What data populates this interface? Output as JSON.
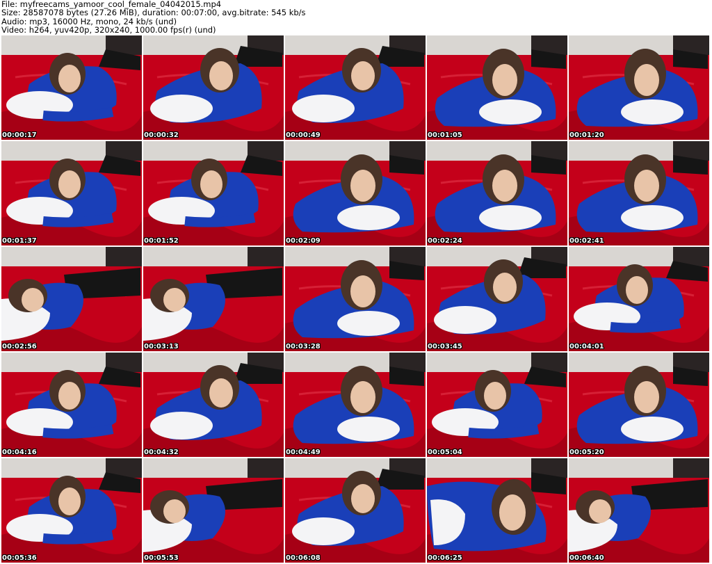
{
  "header": {
    "file_line": "File: myfreecams_yamoor_cool_female_04042015.mp4",
    "size_line": "Size: 28587078 bytes (27.26 MiB), duration: 00:07:00, avg.bitrate: 545 kb/s",
    "audio_line": "Audio: mp3, 16000 Hz, mono, 24 kb/s (und)",
    "video_line": "Video: h264, yuv420p, 320x240, 1000.00 fps(r) (und)"
  },
  "colors": {
    "sheet_red": "#c4001a",
    "sheet_dark_red": "#8e0012",
    "sweater_blue": "#1a3fb8",
    "pillow_white": "#f4f4f6",
    "hair_brown": "#4a3428",
    "skin": "#e8c4a8",
    "wall_grey": "#d9d6d2",
    "pants_black": "#151515"
  },
  "frames": [
    {
      "time": "00:00:17",
      "variant": "a"
    },
    {
      "time": "00:00:32",
      "variant": "b"
    },
    {
      "time": "00:00:49",
      "variant": "b"
    },
    {
      "time": "00:01:05",
      "variant": "c"
    },
    {
      "time": "00:01:20",
      "variant": "c"
    },
    {
      "time": "00:01:37",
      "variant": "a"
    },
    {
      "time": "00:01:52",
      "variant": "a"
    },
    {
      "time": "00:02:09",
      "variant": "c"
    },
    {
      "time": "00:02:24",
      "variant": "c"
    },
    {
      "time": "00:02:41",
      "variant": "c"
    },
    {
      "time": "00:02:56",
      "variant": "d"
    },
    {
      "time": "00:03:13",
      "variant": "d"
    },
    {
      "time": "00:03:28",
      "variant": "c"
    },
    {
      "time": "00:03:45",
      "variant": "b"
    },
    {
      "time": "00:04:01",
      "variant": "a"
    },
    {
      "time": "00:04:16",
      "variant": "a"
    },
    {
      "time": "00:04:32",
      "variant": "b"
    },
    {
      "time": "00:04:49",
      "variant": "c"
    },
    {
      "time": "00:05:04",
      "variant": "a"
    },
    {
      "time": "00:05:20",
      "variant": "c"
    },
    {
      "time": "00:05:36",
      "variant": "a"
    },
    {
      "time": "00:05:53",
      "variant": "d"
    },
    {
      "time": "00:06:08",
      "variant": "b"
    },
    {
      "time": "00:06:25",
      "variant": "e"
    },
    {
      "time": "00:06:40",
      "variant": "d"
    }
  ]
}
